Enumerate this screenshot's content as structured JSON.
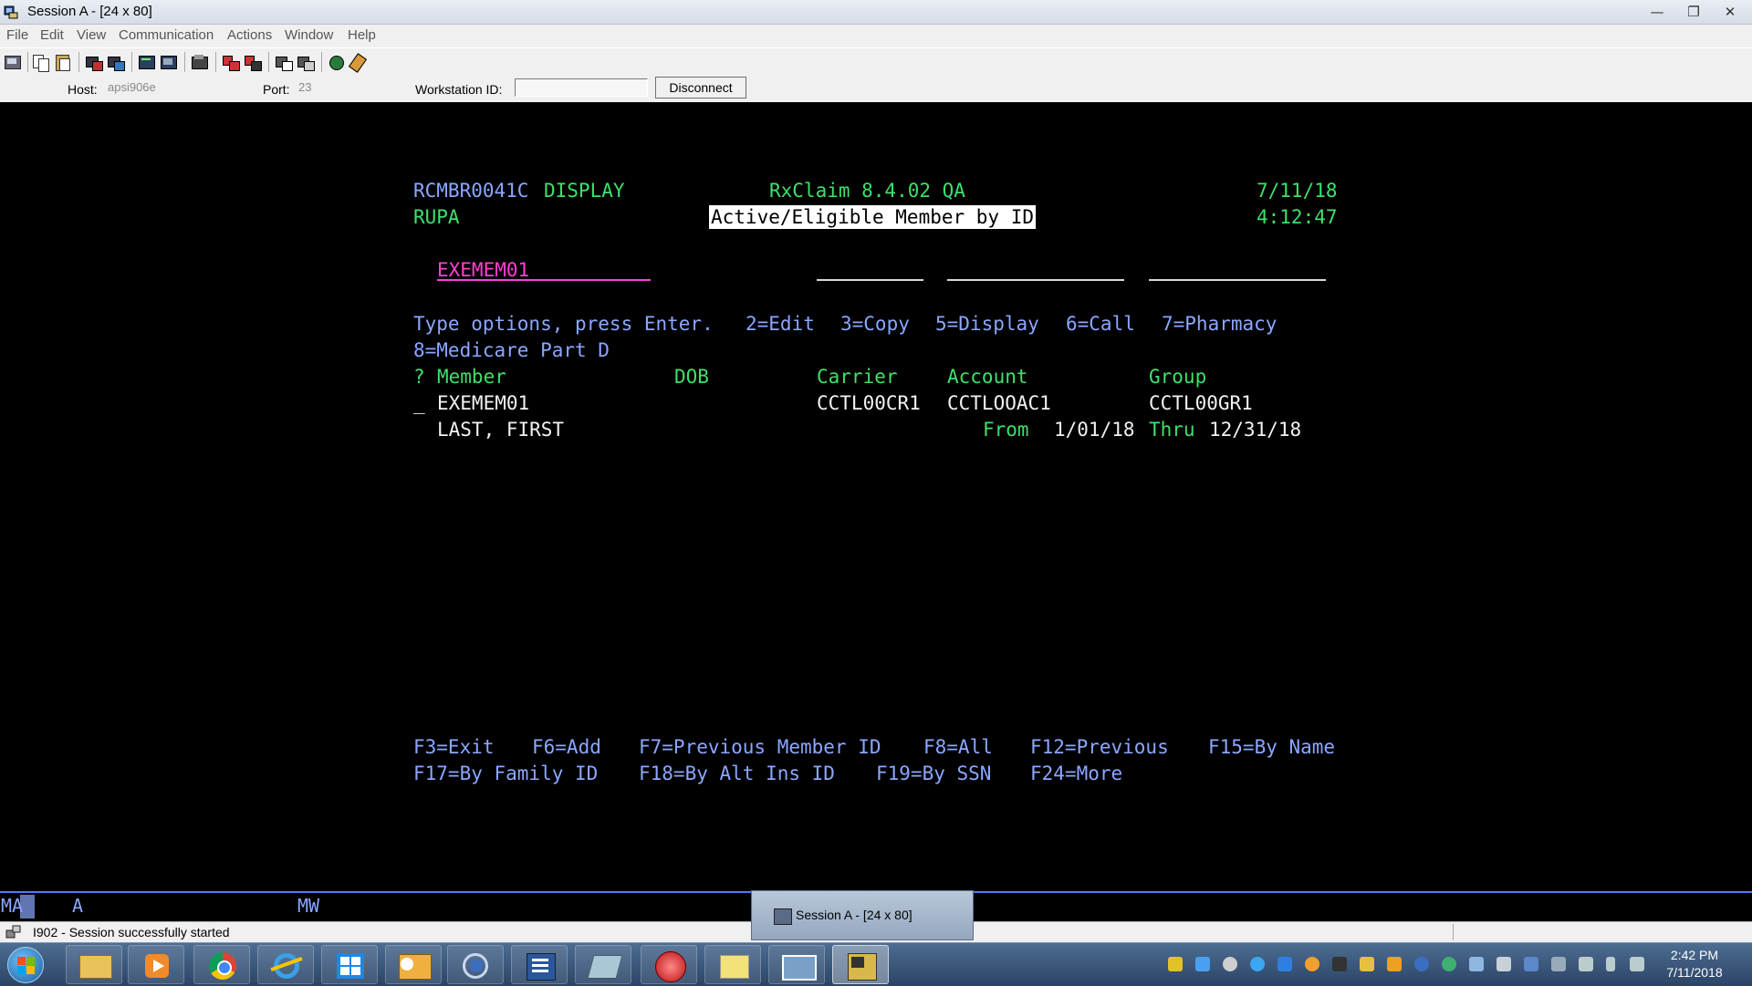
{
  "window": {
    "title": "Session A - [24 x 80]",
    "controls": {
      "minimize": "—",
      "restore": "❐",
      "close": "✕"
    }
  },
  "menu": [
    "File",
    "Edit",
    "View",
    "Communication",
    "Actions",
    "Window",
    "Help"
  ],
  "connection": {
    "host_label": "Host:",
    "host_value": "apsi906e",
    "port_label": "Port:",
    "port_value": "23",
    "workstation_label": "Workstation ID:",
    "workstation_value": "",
    "disconnect_label": "Disconnect"
  },
  "screen": {
    "program": "RCMBR0041C",
    "mode": "DISPLAY",
    "app": "RxClaim 8.4.02 QA",
    "date": "7/11/18",
    "user": "RUPA",
    "title": "Active/Eligible Member by ID",
    "time": "4:12:47",
    "search_member": "EXEMEM01",
    "instructions": "Type options, press Enter.",
    "options": [
      "2=Edit",
      "3=Copy",
      "5=Display",
      "6=Call",
      "7=Pharmacy",
      "8=Medicare Part D"
    ],
    "columns": {
      "sel": "?",
      "member": "Member",
      "dob": "DOB",
      "carrier": "Carrier",
      "account": "Account",
      "group": "Group"
    },
    "rows": [
      {
        "sel": "_",
        "member": "EXEMEM01",
        "carrier": "CCTL00CR1",
        "account": "CCTLOOAC1",
        "group": "CCTL00GR1",
        "name": "LAST, FIRST",
        "from_label": "From",
        "from": "1/01/18",
        "thru_label": "Thru",
        "thru": "12/31/18"
      }
    ],
    "fkeys_line1": [
      "F3=Exit",
      "F6=Add",
      "F7=Previous Member ID",
      "F8=All",
      "F12=Previous",
      "F15=By Name"
    ],
    "fkeys_line2": [
      "F17=By Family ID",
      "F18=By Alt Ins ID",
      "F19=By SSN",
      "F24=More"
    ]
  },
  "oia": {
    "ma": "MA",
    "a": "A",
    "mw": "MW"
  },
  "status": {
    "message": "I902 - Session successfully started"
  },
  "taskbar": {
    "popup_label": "Session A - [24 x 80]",
    "time": "2:42 PM",
    "date": "7/11/2018"
  },
  "colors": {
    "field_blue": "#8ba7ff",
    "output_green": "#3fe06a",
    "input_pink": "#ff3fd2",
    "oia_line": "#5078ff"
  }
}
